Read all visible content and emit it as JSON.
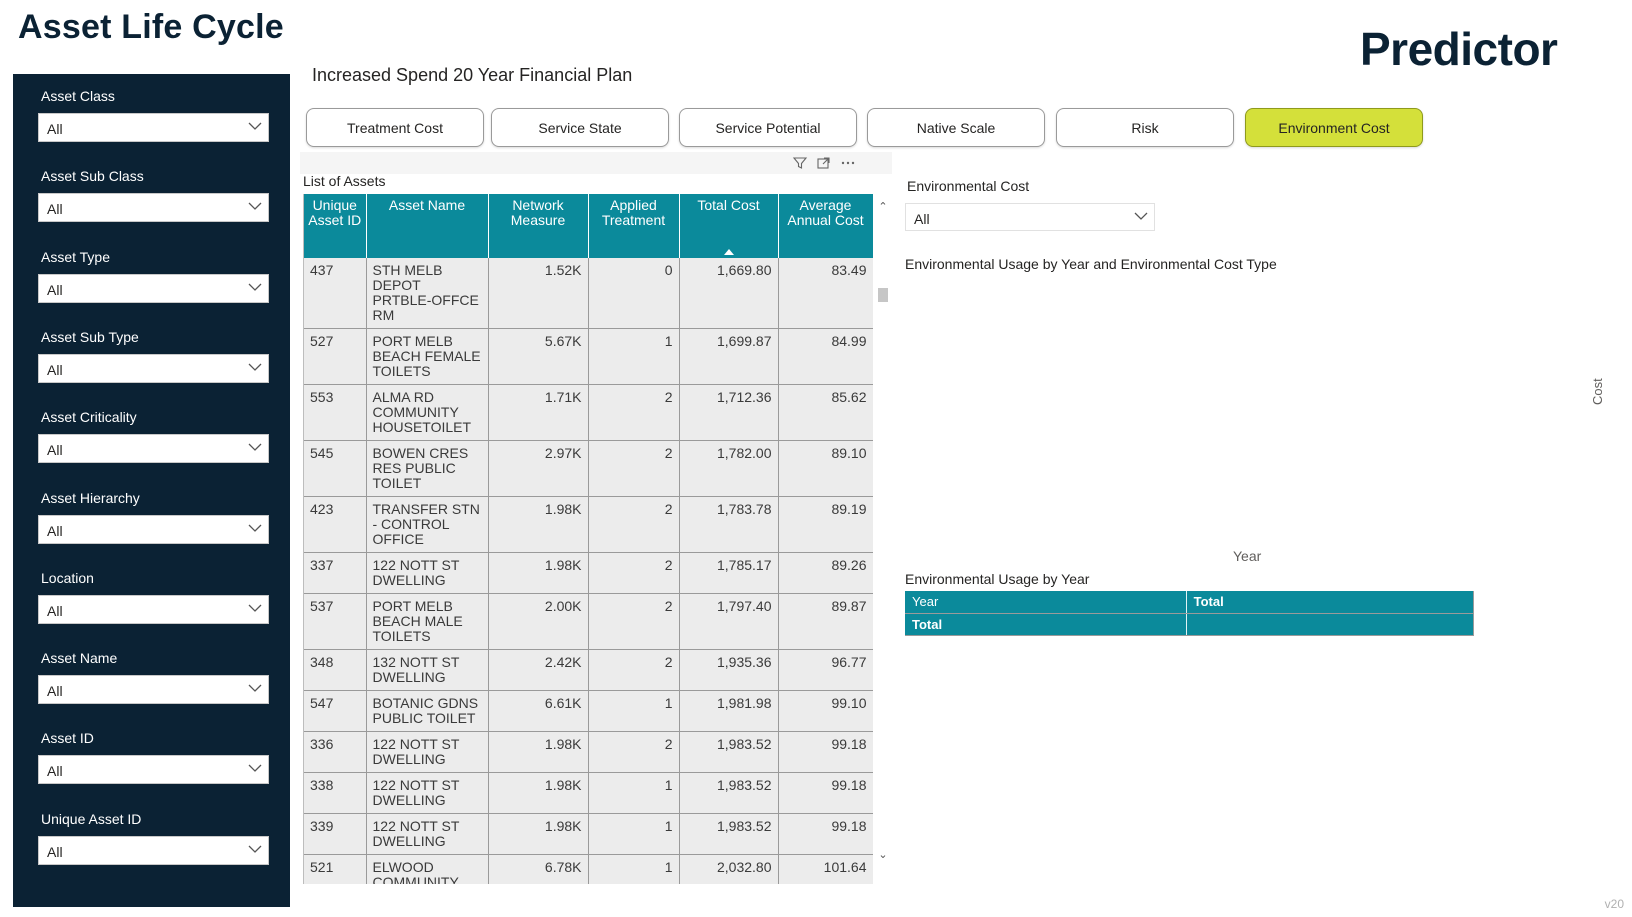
{
  "app": {
    "title": "Asset Life Cycle",
    "brand": "Predictor",
    "version": "v20"
  },
  "report": {
    "title": "Increased Spend 20 Year Financial Plan"
  },
  "sidebar": {
    "filters": [
      {
        "label": "Asset Class",
        "value": "All"
      },
      {
        "label": "Asset Sub Class",
        "value": "All"
      },
      {
        "label": "Asset Type",
        "value": "All"
      },
      {
        "label": "Asset Sub Type",
        "value": "All"
      },
      {
        "label": "Asset Criticality",
        "value": "All"
      },
      {
        "label": "Asset Hierarchy",
        "value": "All"
      },
      {
        "label": "Location",
        "value": "All"
      },
      {
        "label": "Asset Name",
        "value": "All"
      },
      {
        "label": "Asset ID",
        "value": "All"
      },
      {
        "label": "Unique Asset ID",
        "value": "All"
      }
    ]
  },
  "nav": {
    "buttons": [
      {
        "label": "Treatment Cost",
        "active": false
      },
      {
        "label": "Service State",
        "active": false
      },
      {
        "label": "Service Potential",
        "active": false
      },
      {
        "label": "Native Scale",
        "active": false
      },
      {
        "label": "Risk",
        "active": false
      },
      {
        "label": "Environment Cost",
        "active": true
      }
    ],
    "active_color": "#d4e03a"
  },
  "table": {
    "title": "List of Assets",
    "columns": [
      "Unique Asset ID",
      "Asset Name",
      "Network Measure",
      "Applied Treatment",
      "Total Cost",
      "Average Annual Cost"
    ],
    "sorted_column": "Total Cost",
    "header_color": "#0b8a9b",
    "rows": [
      [
        "437",
        "STH MELB DEPOT PRTBLE-OFFCE RM",
        "1.52K",
        "0",
        "1,669.80",
        "83.49"
      ],
      [
        "527",
        "PORT MELB BEACH FEMALE TOILETS",
        "5.67K",
        "1",
        "1,699.87",
        "84.99"
      ],
      [
        "553",
        "ALMA RD COMMUNITY HOUSETOILET",
        "1.71K",
        "2",
        "1,712.36",
        "85.62"
      ],
      [
        "545",
        "BOWEN CRES RES PUBLIC TOILET",
        "2.97K",
        "2",
        "1,782.00",
        "89.10"
      ],
      [
        "423",
        "TRANSFER STN - CONTROL OFFICE",
        "1.98K",
        "2",
        "1,783.78",
        "89.19"
      ],
      [
        "337",
        "122 NOTT ST DWELLING",
        "1.98K",
        "2",
        "1,785.17",
        "89.26"
      ],
      [
        "537",
        "PORT MELB BEACH MALE TOILETS",
        "2.00K",
        "2",
        "1,797.40",
        "89.87"
      ],
      [
        "348",
        "132 NOTT ST DWELLING",
        "2.42K",
        "2",
        "1,935.36",
        "96.77"
      ],
      [
        "547",
        "BOTANIC GDNS PUBLIC TOILET",
        "6.61K",
        "1",
        "1,981.98",
        "99.10"
      ],
      [
        "336",
        "122 NOTT ST DWELLING",
        "1.98K",
        "2",
        "1,983.52",
        "99.18"
      ],
      [
        "338",
        "122 NOTT ST DWELLING",
        "1.98K",
        "1",
        "1,983.52",
        "99.18"
      ],
      [
        "339",
        "122 NOTT ST DWELLING",
        "1.98K",
        "1",
        "1,983.52",
        "99.18"
      ],
      [
        "521",
        "ELWOOD COMMUNITY CTR TOILETS",
        "6.78K",
        "1",
        "2,032.80",
        "101.64"
      ],
      [
        "",
        "",
        "",
        "",
        "",
        ""
      ]
    ]
  },
  "visual_header": {
    "icons": [
      "filter-icon",
      "focus-mode-icon",
      "more-options-icon"
    ]
  },
  "right_panel": {
    "env_cost_label": "Environmental Cost",
    "env_cost_value": "All",
    "chart_title": "Environmental Usage by Year and Environmental Cost Type",
    "y_axis_label": "Cost",
    "x_axis_label": "Year",
    "matrix_title": "Environmental Usage by Year",
    "matrix": {
      "headers": [
        "Year",
        "Total"
      ],
      "total_label": "Total",
      "total_value": ""
    }
  }
}
